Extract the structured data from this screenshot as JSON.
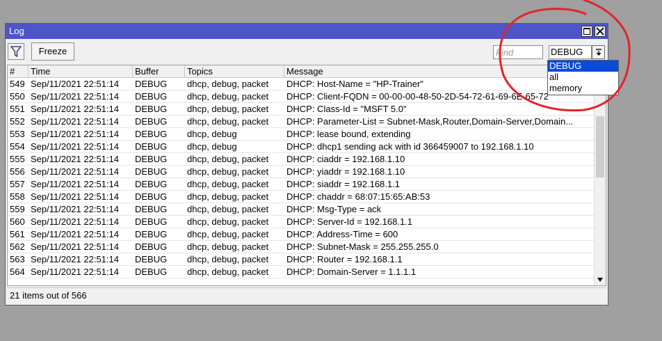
{
  "window": {
    "title": "Log"
  },
  "toolbar": {
    "freeze_label": "Freeze",
    "find_placeholder": "Find",
    "buffer_value": "DEBUG"
  },
  "dropdown": {
    "options": [
      "DEBUG",
      "all",
      "memory"
    ],
    "selected": "DEBUG"
  },
  "table": {
    "columns": [
      "#",
      "Time",
      "Buffer",
      "Topics",
      "Message"
    ],
    "rows": [
      {
        "num": "549",
        "time": "Sep/11/2021 22:51:14",
        "buffer": "DEBUG",
        "topics": "dhcp, debug, packet",
        "message": "DHCP:    Host-Name = \"HP-Trainer\""
      },
      {
        "num": "550",
        "time": "Sep/11/2021 22:51:14",
        "buffer": "DEBUG",
        "topics": "dhcp, debug, packet",
        "message": "DHCP:    Client-FQDN = 00-00-00-48-50-2D-54-72-61-69-6E-65-72"
      },
      {
        "num": "551",
        "time": "Sep/11/2021 22:51:14",
        "buffer": "DEBUG",
        "topics": "dhcp, debug, packet",
        "message": "DHCP:    Class-Id = \"MSFT 5.0\""
      },
      {
        "num": "552",
        "time": "Sep/11/2021 22:51:14",
        "buffer": "DEBUG",
        "topics": "dhcp, debug, packet",
        "message": "DHCP:    Parameter-List = Subnet-Mask,Router,Domain-Server,Domain..."
      },
      {
        "num": "553",
        "time": "Sep/11/2021 22:51:14",
        "buffer": "DEBUG",
        "topics": "dhcp, debug",
        "message": "DHCP: lease bound, extending"
      },
      {
        "num": "554",
        "time": "Sep/11/2021 22:51:14",
        "buffer": "DEBUG",
        "topics": "dhcp, debug",
        "message": "DHCP: dhcp1 sending ack with id 366459007 to 192.168.1.10"
      },
      {
        "num": "555",
        "time": "Sep/11/2021 22:51:14",
        "buffer": "DEBUG",
        "topics": "dhcp, debug, packet",
        "message": "DHCP:    ciaddr = 192.168.1.10"
      },
      {
        "num": "556",
        "time": "Sep/11/2021 22:51:14",
        "buffer": "DEBUG",
        "topics": "dhcp, debug, packet",
        "message": "DHCP:    yiaddr = 192.168.1.10"
      },
      {
        "num": "557",
        "time": "Sep/11/2021 22:51:14",
        "buffer": "DEBUG",
        "topics": "dhcp, debug, packet",
        "message": "DHCP:    siaddr = 192.168.1.1"
      },
      {
        "num": "558",
        "time": "Sep/11/2021 22:51:14",
        "buffer": "DEBUG",
        "topics": "dhcp, debug, packet",
        "message": "DHCP:    chaddr = 68:07:15:65:AB:53"
      },
      {
        "num": "559",
        "time": "Sep/11/2021 22:51:14",
        "buffer": "DEBUG",
        "topics": "dhcp, debug, packet",
        "message": "DHCP:    Msg-Type = ack"
      },
      {
        "num": "560",
        "time": "Sep/11/2021 22:51:14",
        "buffer": "DEBUG",
        "topics": "dhcp, debug, packet",
        "message": "DHCP:    Server-Id = 192.168.1.1"
      },
      {
        "num": "561",
        "time": "Sep/11/2021 22:51:14",
        "buffer": "DEBUG",
        "topics": "dhcp, debug, packet",
        "message": "DHCP:    Address-Time = 600"
      },
      {
        "num": "562",
        "time": "Sep/11/2021 22:51:14",
        "buffer": "DEBUG",
        "topics": "dhcp, debug, packet",
        "message": "DHCP:    Subnet-Mask = 255.255.255.0"
      },
      {
        "num": "563",
        "time": "Sep/11/2021 22:51:14",
        "buffer": "DEBUG",
        "topics": "dhcp, debug, packet",
        "message": "DHCP:    Router = 192.168.1.1"
      },
      {
        "num": "564",
        "time": "Sep/11/2021 22:51:14",
        "buffer": "DEBUG",
        "topics": "dhcp, debug, packet",
        "message": "DHCP:    Domain-Server = 1.1.1.1"
      }
    ]
  },
  "status": {
    "text": "21 items out of 566"
  },
  "colors": {
    "titlebar": "#4d55c8",
    "selection": "#0a4bd8",
    "annotation": "#e0242c"
  },
  "icons": [
    "filter-icon",
    "maximize-icon",
    "close-icon",
    "dropdown-arrow-icon",
    "scroll-down-icon"
  ]
}
